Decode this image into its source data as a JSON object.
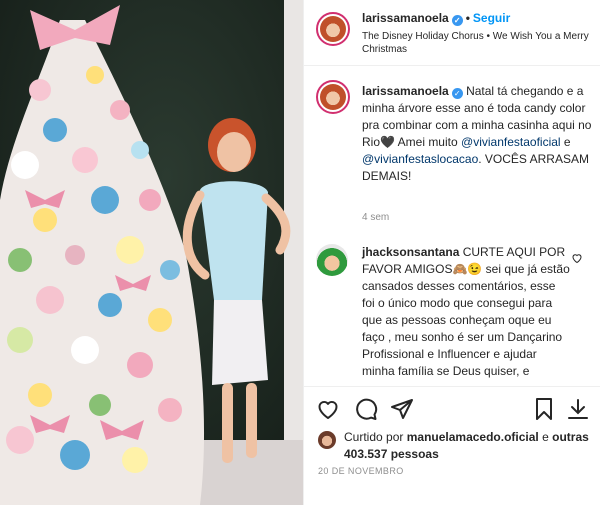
{
  "post": {
    "username": "larissamanoela",
    "follow_label": "Seguir",
    "separator": "•",
    "song": "The Disney Holiday Chorus • We Wish You a Merry Christmas"
  },
  "caption": {
    "username": "larissamanoela",
    "text_1": "Natal tá chegando e a minha árvore esse ano é toda candy color pra combinar com a minha casinha aqui no Rio",
    "emoji": "🖤",
    "text_2": "Amei muito",
    "mention_1": "@vivianfestaoficial",
    "text_3": "e",
    "mention_2": "@vivianfestaslocacao",
    "text_4": ". VOCÊS ARRASAM DEMAIS!",
    "time": "4 sem"
  },
  "comment": {
    "username": "jhacksonsantana",
    "text": "CURTE AQUI POR FAVOR AMIGOS🙈😉 sei que já estão cansados desses comentários, esse foi o único modo que consegui para que as pessoas conheçam oque eu faço , meu sonho é ser um Dançarino Profissional e Influencer e ajudar minha família se Deus quiser, e"
  },
  "likes": {
    "prefix": "Curtido por",
    "liker": "manuelamacedo.oficial",
    "connector": "e",
    "others": "outras 403.537 pessoas"
  },
  "date": "20 DE NOVEMBRO",
  "icons": {
    "like": "heart-icon",
    "comment": "comment-icon",
    "share": "share-icon",
    "save": "bookmark-icon",
    "download": "download-icon",
    "verified": "verified-badge-icon"
  },
  "colors": {
    "accent_blue": "#0095f6",
    "mention_blue": "#00376b",
    "muted": "#8e8e8e"
  }
}
